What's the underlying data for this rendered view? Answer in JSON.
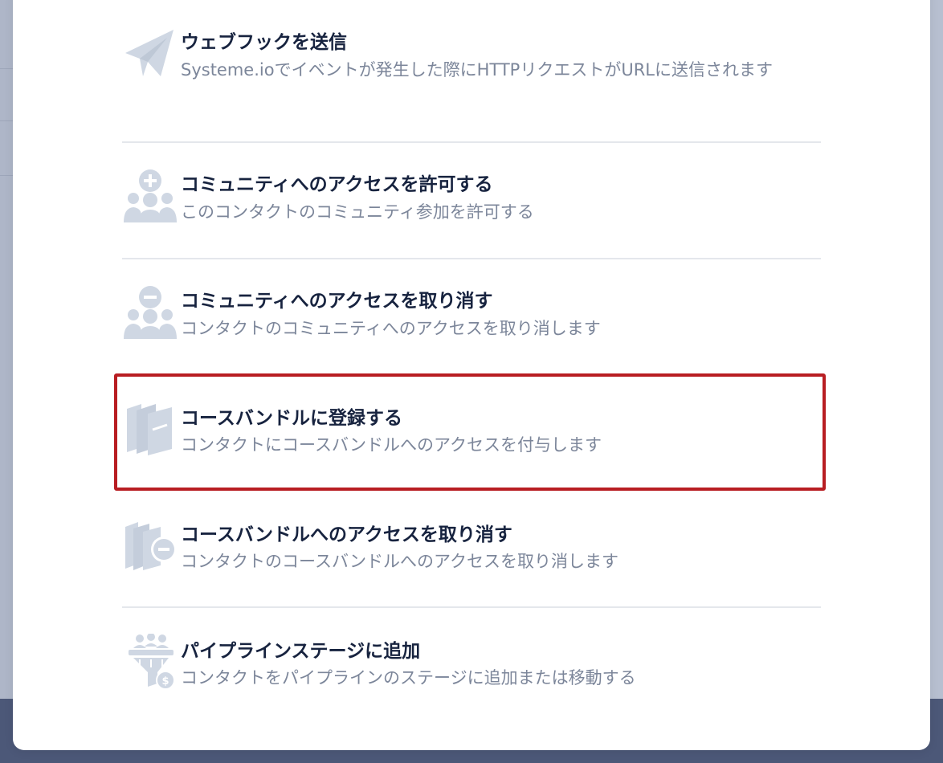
{
  "actions": [
    {
      "title": "ウェブフックを送信",
      "description": "Systeme.ioでイベントが発生した際にHTTPリクエストがURLに送信されます",
      "icon": "paper-plane-icon"
    },
    {
      "title": "コミュニティへのアクセスを許可する",
      "description": "このコンタクトのコミュニティ参加を許可する",
      "icon": "community-add-icon"
    },
    {
      "title": "コミュニティへのアクセスを取り消す",
      "description": "コンタクトのコミュニティへのアクセスを取り消します",
      "icon": "community-remove-icon"
    },
    {
      "title": "コースバンドルに登録する",
      "description": "コンタクトにコースバンドルへのアクセスを付与します",
      "icon": "course-bundle-icon",
      "highlighted": true
    },
    {
      "title": "コースバンドルへのアクセスを取り消す",
      "description": "コンタクトのコースバンドルへのアクセスを取り消します",
      "icon": "course-bundle-remove-icon"
    },
    {
      "title": "パイプラインステージに追加",
      "description": "コンタクトをパイプラインのステージに追加または移動する",
      "icon": "pipeline-funnel-icon"
    }
  ],
  "colors": {
    "title": "#17233f",
    "description": "#7c869a",
    "icon": "#cfd7e3",
    "highlight_border": "#b81d22",
    "divider": "#e4e7ec"
  }
}
